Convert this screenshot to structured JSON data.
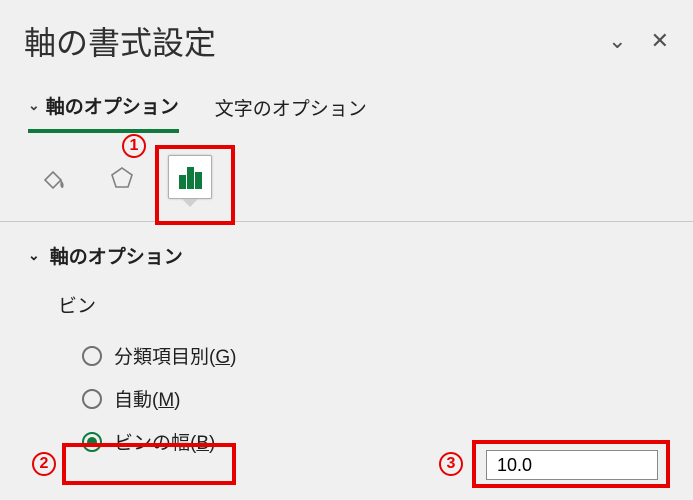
{
  "header": {
    "title": "軸の書式設定"
  },
  "tabs": {
    "axis_options": "軸のオプション",
    "text_options": "文字のオプション"
  },
  "icons": {
    "fill": "fill-line-icon",
    "effects": "effects-icon",
    "chart": "axis-options-chart-icon"
  },
  "section": {
    "title": "軸のオプション",
    "bin_label": "ビン",
    "radios": {
      "by_category": {
        "label": "分類項目別(",
        "key": "G",
        "close": ")"
      },
      "automatic": {
        "label": "自動(",
        "key": "M",
        "close": ")"
      },
      "bin_width": {
        "label": "ビンの幅(",
        "key": "B",
        "close": ")"
      }
    },
    "bin_width_value": "10.0"
  },
  "annotations": {
    "n1": "1",
    "n2": "2",
    "n3": "3"
  }
}
